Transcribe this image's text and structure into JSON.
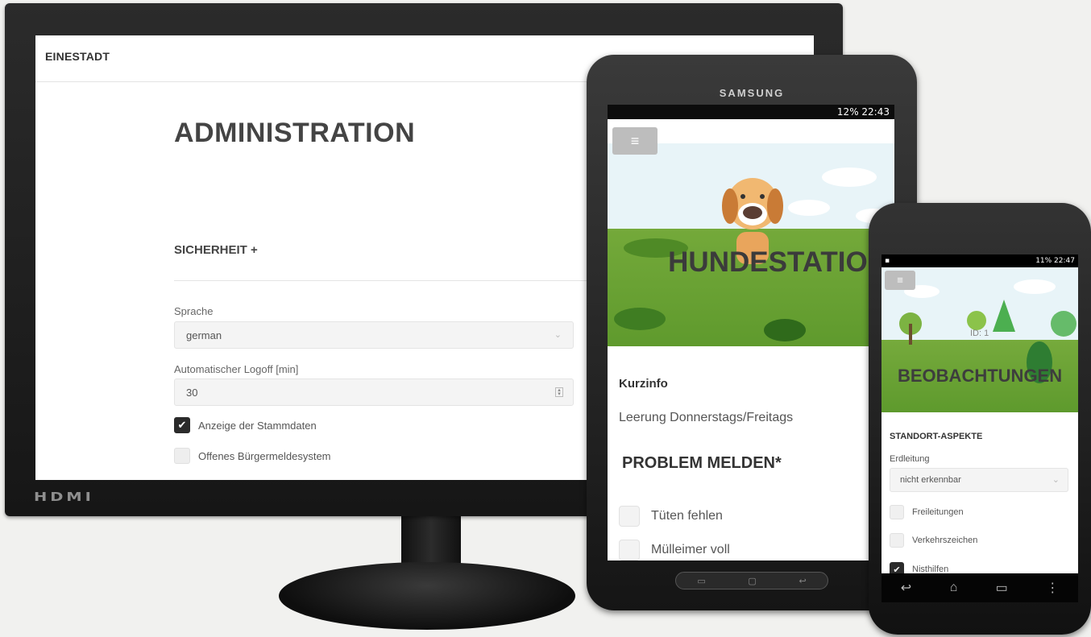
{
  "monitor": {
    "brand_label": "HDMI",
    "app": {
      "brand": "EINESTADT",
      "title": "ADMINISTRATION",
      "section": "SICHERHEIT +",
      "language_label": "Sprache",
      "language_value": "german",
      "logoff_label": "Automatischer Logoff [min]",
      "logoff_value": "30",
      "checkboxes": [
        {
          "label": "Anzeige der Stammdaten",
          "checked": true
        },
        {
          "label": "Offenes Bürgermeldesystem",
          "checked": false
        }
      ]
    }
  },
  "tablet": {
    "brand": "SAMSUNG",
    "status": "12% 22:43",
    "app": {
      "hero_title": "HUNDESTATION",
      "info_heading": "Kurzinfo",
      "info_text": "Leerung Donnerstags/Freitags",
      "report_heading": "PROBLEM MELDEN*",
      "checkboxes": [
        {
          "label": "Tüten fehlen",
          "checked": false
        },
        {
          "label": "Mülleimer voll",
          "checked": false
        }
      ]
    }
  },
  "phone": {
    "status_right": "11% 22:47",
    "app": {
      "id_label": "ID: 1",
      "hero_title": "BEOBACHTUNGEN",
      "section": "STANDORT-ASPEKTE",
      "select_label": "Erdleitung",
      "select_value": "nicht erkennbar",
      "checkboxes": [
        {
          "label": "Freileitungen",
          "checked": false
        },
        {
          "label": "Verkehrszeichen",
          "checked": false
        },
        {
          "label": "Nisthilfen",
          "checked": true
        }
      ]
    }
  }
}
